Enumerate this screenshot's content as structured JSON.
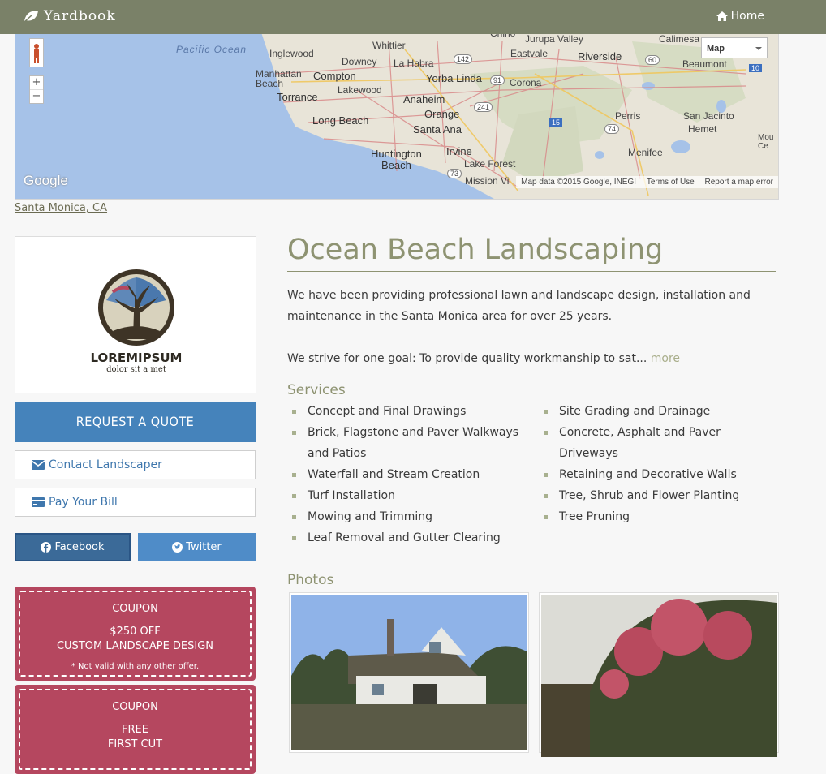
{
  "nav": {
    "brand": "Yardbook",
    "home_label": "Home"
  },
  "map": {
    "labels": {
      "pacific": "Pacific Ocean",
      "inglewood": "Inglewood",
      "whittier": "Whittier",
      "downey": "Downey",
      "lahabra": "La Habra",
      "eastvale": "Eastvale",
      "jurupa": "Jurupa Valley",
      "riverside": "Riverside",
      "calimesa": "Calimesa",
      "manhattan": "Manhattan\nBeach",
      "compton": "Compton",
      "yorba": "Yorba Linda",
      "corona": "Corona",
      "beaumont": "Beaumont",
      "torrance": "Torrance",
      "lakewood": "Lakewood",
      "anaheim": "Anaheim",
      "orange": "Orange",
      "perris": "Perris",
      "sanjacinto": "San Jacinto",
      "hemet": "Hemet",
      "longbeach": "Long Beach",
      "santaana": "Santa Ana",
      "huntington": "Huntington\nBeach",
      "irvine": "Irvine",
      "menifee": "Menifee",
      "lakeforest": "Lake Forest",
      "missionviejo": "Mission Vi",
      "moc": "Mou\nCe",
      "chino": "Chino",
      "r142": "142",
      "r91": "91",
      "r60": "60",
      "r241": "241",
      "r15": "15",
      "r74": "74",
      "r73": "73",
      "r10": "10"
    },
    "type_label": "Map",
    "google": "Google",
    "attribution": {
      "data": "Map data ©2015 Google, INEGI",
      "terms": "Terms of Use",
      "report": "Report a map error"
    },
    "zoom_in": "+",
    "zoom_out": "−"
  },
  "location": "Santa Monica, CA",
  "logo": {
    "word": "LOREMIPSUM",
    "tagline": "dolor sit a met"
  },
  "sidebar": {
    "quote_label": "REQUEST A QUOTE",
    "contact_label": "Contact Landscaper",
    "pay_label": "Pay Your Bill",
    "facebook_label": "Facebook",
    "twitter_label": "Twitter"
  },
  "coupons": [
    {
      "title": "COUPON",
      "line1": "$250 OFF",
      "line2": "CUSTOM LANDSCAPE DESIGN",
      "note": "* Not valid with any other offer."
    },
    {
      "title": "COUPON",
      "line1": "FREE",
      "line2": "FIRST CUT",
      "note": ""
    }
  ],
  "business": {
    "name": "Ocean Beach Landscaping",
    "desc1": "We have been providing professional lawn and landscape design, installation and maintenance in the Santa Monica area for over 25 years.",
    "desc2": "We strive for one goal: To provide quality workmanship to sat...",
    "more_label": "more"
  },
  "services": {
    "heading": "Services",
    "col1": [
      "Concept and Final Drawings",
      "Brick, Flagstone and Paver Walkways and Patios",
      "Waterfall and Stream Creation",
      "Turf Installation",
      "Mowing and Trimming",
      "Leaf Removal and Gutter Clearing"
    ],
    "col2": [
      "Site Grading and Drainage",
      "Concrete, Asphalt and Paver Driveways",
      "Retaining and Decorative Walls",
      "Tree, Shrub and Flower Planting",
      "Tree Pruning"
    ]
  },
  "photos": {
    "heading": "Photos"
  },
  "colors": {
    "nav": "#7a8168",
    "accent": "#8e9372",
    "button_blue": "#4583bb",
    "facebook": "#3b6a98",
    "twitter": "#4f8cc8",
    "coupon": "#b5475f"
  }
}
